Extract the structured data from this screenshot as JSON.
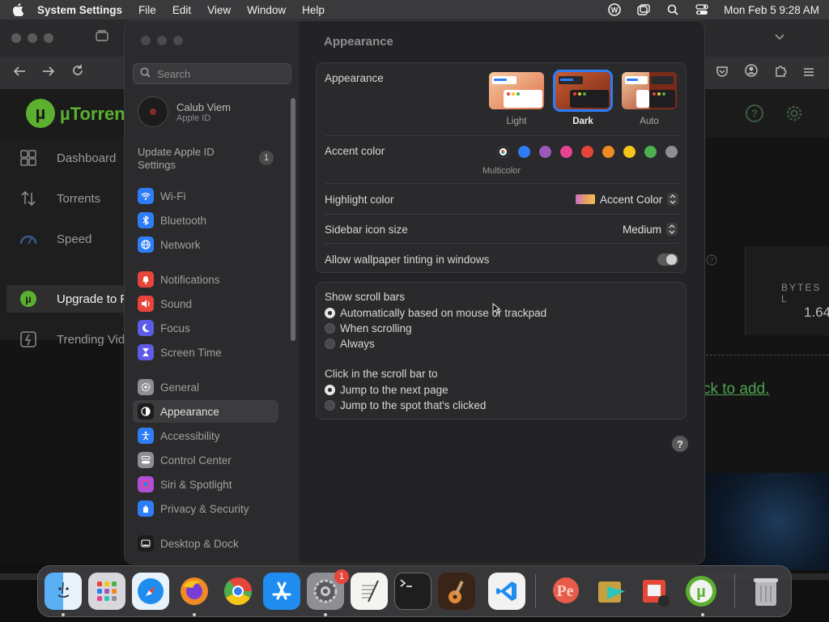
{
  "menubar": {
    "app_name": "System Settings",
    "menus": [
      "File",
      "Edit",
      "View",
      "Window",
      "Help"
    ],
    "clock": "Mon Feb 5  9:28 AM"
  },
  "background_app": {
    "brand": "µTorrent",
    "nav": [
      "Dashboard",
      "Torrents",
      "Speed",
      "Upgrade to P",
      "Trending Vid"
    ],
    "card_label": "BYTES L",
    "card_value": "1.64",
    "add_hint": "ck to add."
  },
  "sidebar": {
    "search_placeholder": "Search",
    "user_name": "Calub Viem",
    "user_sub": "Apple ID",
    "update_label": "Update Apple ID Settings",
    "update_badge": "1",
    "items": [
      {
        "label": "Wi-Fi",
        "icon": "wifi-icon",
        "color": "#2f7df6"
      },
      {
        "label": "Bluetooth",
        "icon": "bluetooth-icon",
        "color": "#2f7df6"
      },
      {
        "label": "Network",
        "icon": "globe-icon",
        "color": "#2f7df6"
      },
      {
        "label": "Notifications",
        "icon": "bell-icon",
        "color": "#e6463a"
      },
      {
        "label": "Sound",
        "icon": "speaker-icon",
        "color": "#e6463a"
      },
      {
        "label": "Focus",
        "icon": "moon-icon",
        "color": "#5e5ce6"
      },
      {
        "label": "Screen Time",
        "icon": "hourglass-icon",
        "color": "#5e5ce6"
      },
      {
        "label": "General",
        "icon": "gear-icon",
        "color": "#8e8e93"
      },
      {
        "label": "Appearance",
        "icon": "appearance-icon",
        "color": "#1c1c1e"
      },
      {
        "label": "Accessibility",
        "icon": "accessibility-icon",
        "color": "#2f7df6"
      },
      {
        "label": "Control Center",
        "icon": "control-center-icon",
        "color": "#8e8e93"
      },
      {
        "label": "Siri & Spotlight",
        "icon": "siri-icon",
        "color": "#b04fd6"
      },
      {
        "label": "Privacy & Security",
        "icon": "hand-icon",
        "color": "#2f7df6"
      },
      {
        "label": "Desktop & Dock",
        "icon": "dock-icon",
        "color": "#1c1c1e"
      }
    ]
  },
  "main": {
    "page_title": "Appearance",
    "appearance_label": "Appearance",
    "appearance_options": [
      {
        "label": "Light",
        "selected": false
      },
      {
        "label": "Dark",
        "selected": true
      },
      {
        "label": "Auto",
        "selected": false
      }
    ],
    "accent_label": "Accent color",
    "accent_colors": [
      "#ffffff",
      "#2f7df6",
      "#9b59b6",
      "#e84393",
      "#e6463a",
      "#f08a24",
      "#f5c518",
      "#4caf50",
      "#8e8e93"
    ],
    "accent_selected_caption": "Multicolor",
    "highlight_label": "Highlight color",
    "highlight_value": "Accent Color",
    "sidebar_icon_label": "Sidebar icon size",
    "sidebar_icon_value": "Medium",
    "wallpaper_tint_label": "Allow wallpaper tinting in windows",
    "wallpaper_tint_on": false,
    "scroll_bars_label": "Show scroll bars",
    "scroll_bars_options": [
      {
        "label": "Automatically based on mouse or trackpad",
        "selected": true
      },
      {
        "label": "When scrolling",
        "selected": false
      },
      {
        "label": "Always",
        "selected": false
      }
    ],
    "click_scroll_label": "Click in the scroll bar to",
    "click_scroll_options": [
      {
        "label": "Jump to the next page",
        "selected": true
      },
      {
        "label": "Jump to the spot that's clicked",
        "selected": false
      }
    ],
    "help_label": "?"
  },
  "dock": {
    "apps": [
      "Finder",
      "Launchpad",
      "Safari",
      "Firefox",
      "Chrome",
      "App Store",
      "System Settings",
      "TextEdit",
      "Terminal",
      "GarageBand",
      "VS Code",
      "Preview",
      "Migration",
      "Photo Booth",
      "µTorrent",
      "Trash"
    ],
    "settings_badge": "1"
  }
}
